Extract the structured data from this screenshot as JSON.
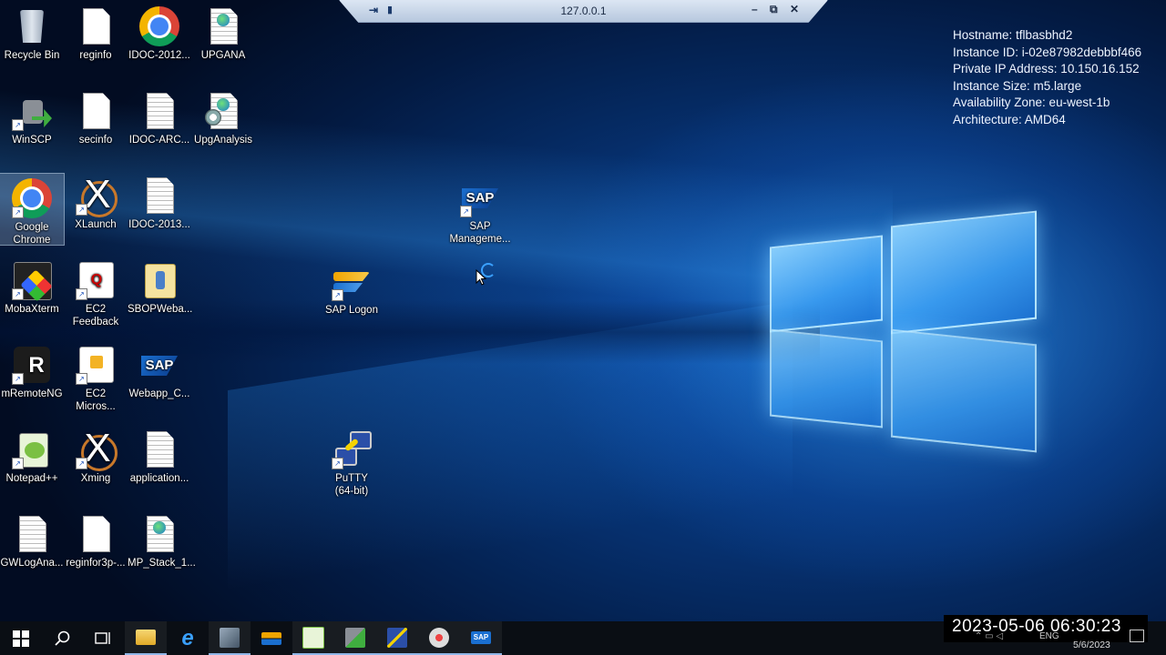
{
  "remote_bar": {
    "title": "127.0.0.1",
    "minimize": "–",
    "restore": "⧉",
    "close": "✕"
  },
  "instance_info": [
    "Hostname: tflbasbhd2",
    "Instance ID: i-02e87982debbbf466",
    "Private IP Address: 10.150.16.152",
    "Instance Size: m5.large",
    "Availability Zone: eu-west-1b",
    "Architecture: AMD64"
  ],
  "desktop_icons": {
    "recycle_bin": "Recycle Bin",
    "reginfo": "reginfo",
    "idoc_2012": "IDOC-2012...",
    "upgana": "UPGANA",
    "winscp": "WinSCP",
    "secinfo": "secinfo",
    "idoc_arc": "IDOC-ARC...",
    "upganalysis": "UpgAnalysis",
    "google_chrome_1": "Google",
    "google_chrome_2": "Chrome",
    "xlaunch": "XLaunch",
    "idoc_2013": "IDOC-2013...",
    "mobaxterm": "MobaXterm",
    "ec2_feedback_1": "EC2",
    "ec2_feedback_2": "Feedback",
    "sbopweba": "SBOPWeba...",
    "mremoteng": "mRemoteNG",
    "ec2_micros_1": "EC2",
    "ec2_micros_2": "Micros...",
    "webapp_c": "Webapp_C...",
    "notepadpp": "Notepad++",
    "xming": "Xming",
    "application": "application...",
    "gwloganalysis": "GWLogAna...",
    "reginfor3p": "reginfor3p-...",
    "mp_stack": "MP_Stack_1...",
    "sap_logon": "SAP Logon",
    "sap_management_1": "SAP",
    "sap_management_2": "Manageme...",
    "putty_1": "PuTTY",
    "putty_2": "(64-bit)"
  },
  "sap_badge": "SAP",
  "taskbar": {
    "clock": "2023-05-06  06:30:23",
    "date": "5/6/2023",
    "language": "ENG"
  },
  "colors": {
    "accent": "#1a6fd0",
    "taskbar": "#0a0e14"
  }
}
